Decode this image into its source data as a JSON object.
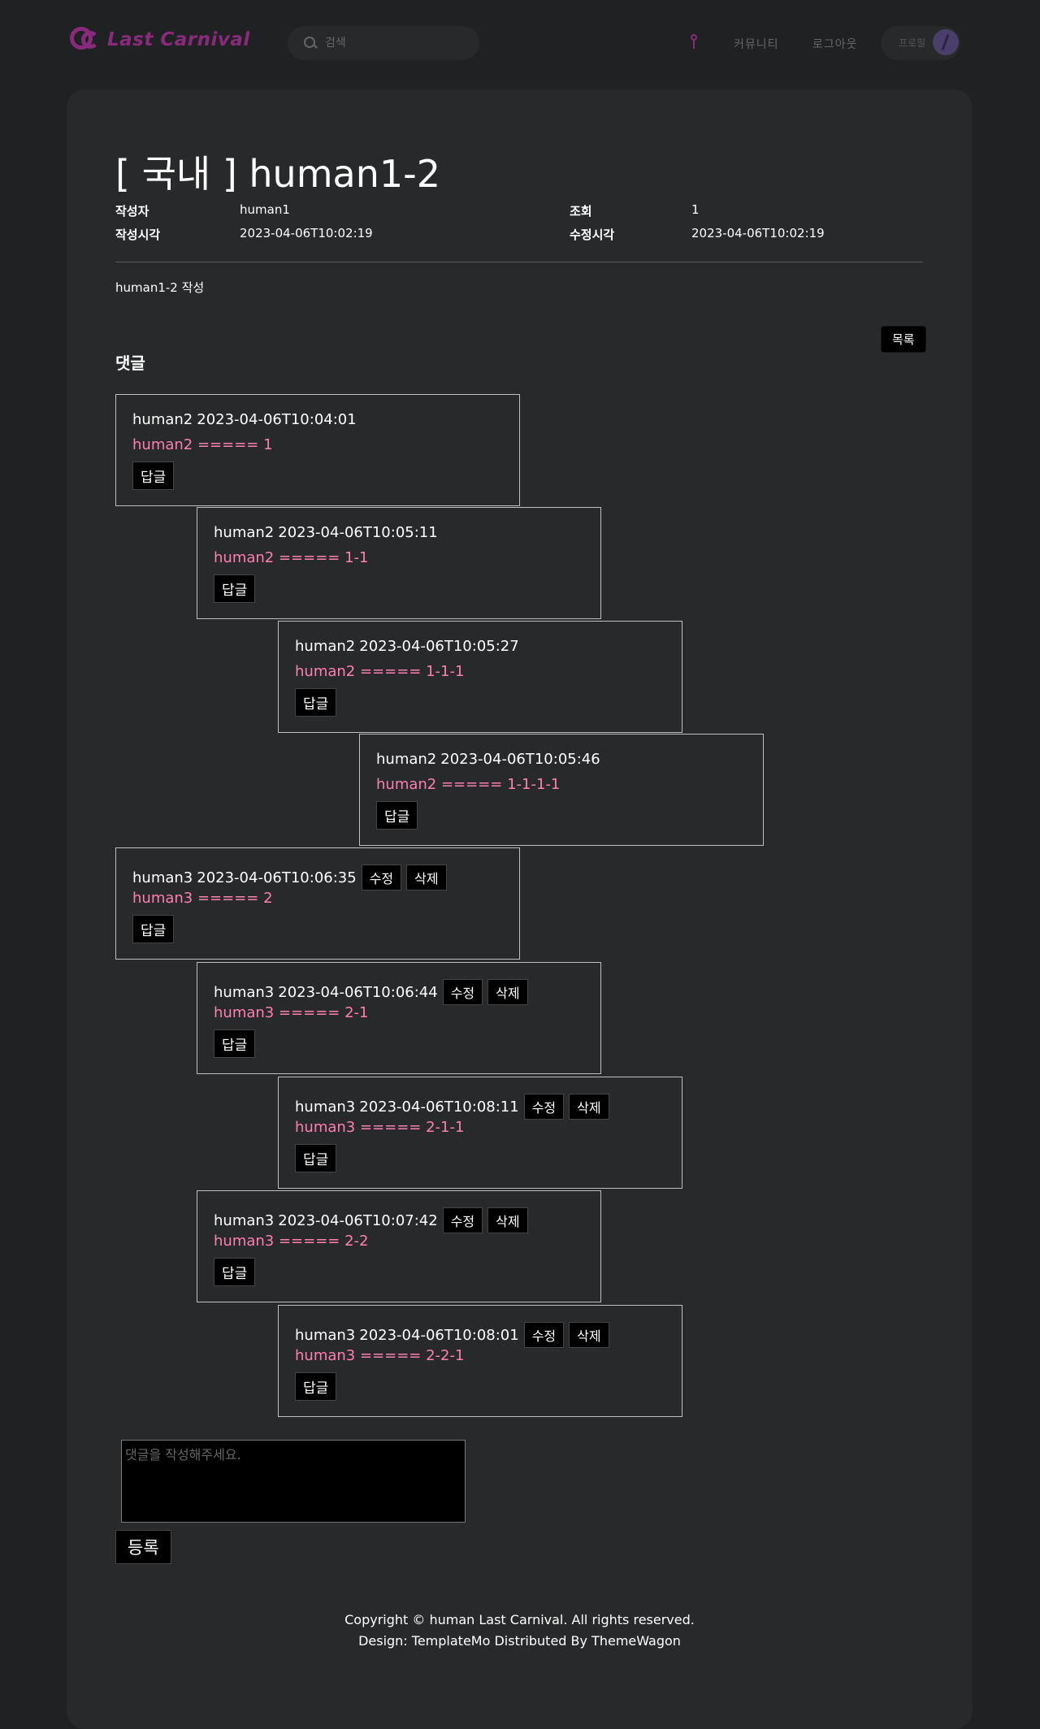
{
  "header": {
    "logo_text": "Last Carnival",
    "search_placeholder": "검색",
    "nav_community": "커뮤니티",
    "nav_logout": "로그아웃",
    "profile_label": "프로필"
  },
  "post": {
    "title": "[ 국내 ] human1-2",
    "author_label": "작성자",
    "author": "human1",
    "views_label": "조회",
    "views": "1",
    "created_label": "작성시각",
    "created": "2023-04-06T10:02:19",
    "updated_label": "수정시각",
    "updated": "2023-04-06T10:02:19",
    "body": "human1-2 작성",
    "list_button": "목록"
  },
  "comments_heading": "댓글",
  "comments": [
    {
      "author": "human2",
      "date": "2023-04-06T10:04:01",
      "text": "human2 ===== 1",
      "owner": false
    },
    {
      "author": "human2",
      "date": "2023-04-06T10:05:11",
      "text": "human2 ===== 1-1",
      "owner": false
    },
    {
      "author": "human2",
      "date": "2023-04-06T10:05:27",
      "text": "human2 ===== 1-1-1",
      "owner": false
    },
    {
      "author": "human2",
      "date": "2023-04-06T10:05:46",
      "text": "human2 ===== 1-1-1-1",
      "owner": false
    },
    {
      "author": "human3",
      "date": "2023-04-06T10:06:35",
      "text": "human3 ===== 2",
      "owner": true
    },
    {
      "author": "human3",
      "date": "2023-04-06T10:06:44",
      "text": "human3 ===== 2-1",
      "owner": true
    },
    {
      "author": "human3",
      "date": "2023-04-06T10:08:11",
      "text": "human3 ===== 2-1-1",
      "owner": true
    },
    {
      "author": "human3",
      "date": "2023-04-06T10:07:42",
      "text": "human3 ===== 2-2",
      "owner": true
    },
    {
      "author": "human3",
      "date": "2023-04-06T10:08:01",
      "text": "human3 ===== 2-2-1",
      "owner": true
    }
  ],
  "comment_actions": {
    "edit": "수정",
    "delete": "삭제",
    "reply": "답글"
  },
  "new_comment": {
    "placeholder": "댓글을 작성해주세요.",
    "submit": "등록"
  },
  "footer": {
    "copyright": "Copyright © human Last Carnival. All rights reserved.",
    "credit": "Design: TemplateMo Distributed By ThemeWagon"
  },
  "colors": {
    "background": "#1f2122",
    "card": "#27292a",
    "accent": "#8a2a7c",
    "comment_text": "#ff7fb1"
  }
}
